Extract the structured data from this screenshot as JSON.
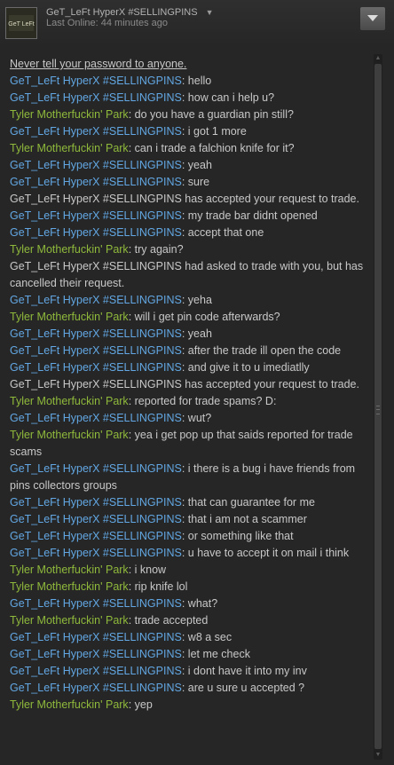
{
  "header": {
    "friend_name": "GeT_LeFt HyperX #SELLINGPINS",
    "last_online": "Last Online: 44 minutes ago",
    "menu_icon": "chevron-down-icon",
    "avatar_text": "GeT LeFt"
  },
  "chat": {
    "warning": "Never tell your password to anyone.",
    "messages": [
      {
        "type": "msg",
        "speaker": "get",
        "sender": "GeT_LeFt HyperX #SELLINGPINS",
        "text": ": hello"
      },
      {
        "type": "msg",
        "speaker": "get",
        "sender": "GeT_LeFt HyperX #SELLINGPINS",
        "text": ": how can i help u?"
      },
      {
        "type": "msg",
        "speaker": "tyler",
        "sender": "Tyler Motherfuckin' Park",
        "text": ": do you have a guardian pin still?"
      },
      {
        "type": "msg",
        "speaker": "get",
        "sender": "GeT_LeFt HyperX #SELLINGPINS",
        "text": ": i got 1 more"
      },
      {
        "type": "msg",
        "speaker": "tyler",
        "sender": "Tyler Motherfuckin' Park",
        "text": ": can i trade a falchion knife for it?"
      },
      {
        "type": "msg",
        "speaker": "get",
        "sender": "GeT_LeFt HyperX #SELLINGPINS",
        "text": ": yeah"
      },
      {
        "type": "msg",
        "speaker": "get",
        "sender": "GeT_LeFt HyperX #SELLINGPINS",
        "text": ": sure"
      },
      {
        "type": "sys",
        "text": "GeT_LeFt HyperX #SELLINGPINS has accepted your request to trade."
      },
      {
        "type": "msg",
        "speaker": "get",
        "sender": "GeT_LeFt HyperX #SELLINGPINS",
        "text": ": my trade bar didnt opened"
      },
      {
        "type": "msg",
        "speaker": "get",
        "sender": "GeT_LeFt HyperX #SELLINGPINS",
        "text": ": accept that one"
      },
      {
        "type": "msg",
        "speaker": "tyler",
        "sender": "Tyler Motherfuckin' Park",
        "text": ": try again?"
      },
      {
        "type": "sys",
        "text": "GeT_LeFt HyperX #SELLINGPINS had asked to trade with you, but has cancelled their request."
      },
      {
        "type": "msg",
        "speaker": "get",
        "sender": "GeT_LeFt HyperX #SELLINGPINS",
        "text": ": yeha"
      },
      {
        "type": "msg",
        "speaker": "tyler",
        "sender": "Tyler Motherfuckin' Park",
        "text": ": will i get pin code afterwards?"
      },
      {
        "type": "msg",
        "speaker": "get",
        "sender": "GeT_LeFt HyperX #SELLINGPINS",
        "text": ": yeah"
      },
      {
        "type": "msg",
        "speaker": "get",
        "sender": "GeT_LeFt HyperX #SELLINGPINS",
        "text": ": after the trade ill open the code"
      },
      {
        "type": "msg",
        "speaker": "get",
        "sender": "GeT_LeFt HyperX #SELLINGPINS",
        "text": ": and give it to u imediatlly"
      },
      {
        "type": "sys",
        "text": "GeT_LeFt HyperX #SELLINGPINS has accepted your request to trade."
      },
      {
        "type": "msg",
        "speaker": "tyler",
        "sender": "Tyler Motherfuckin' Park",
        "text": ": reported for trade spams? D:"
      },
      {
        "type": "msg",
        "speaker": "get",
        "sender": "GeT_LeFt HyperX #SELLINGPINS",
        "text": ": wut?"
      },
      {
        "type": "msg",
        "speaker": "tyler",
        "sender": "Tyler Motherfuckin' Park",
        "text": ": yea i get pop up that saids reported for trade scams"
      },
      {
        "type": "msg",
        "speaker": "get",
        "sender": "GeT_LeFt HyperX #SELLINGPINS",
        "text": ": i there is a bug i have friends from pins collectors groups"
      },
      {
        "type": "msg",
        "speaker": "get",
        "sender": "GeT_LeFt HyperX #SELLINGPINS",
        "text": ": that can guarantee for me"
      },
      {
        "type": "msg",
        "speaker": "get",
        "sender": "GeT_LeFt HyperX #SELLINGPINS",
        "text": ": that i am not a scammer"
      },
      {
        "type": "msg",
        "speaker": "get",
        "sender": "GeT_LeFt HyperX #SELLINGPINS",
        "text": ": or something like that"
      },
      {
        "type": "msg",
        "speaker": "get",
        "sender": "GeT_LeFt HyperX #SELLINGPINS",
        "text": ": u have to accept it on mail i think"
      },
      {
        "type": "msg",
        "speaker": "tyler",
        "sender": "Tyler Motherfuckin' Park",
        "text": ": i know"
      },
      {
        "type": "msg",
        "speaker": "tyler",
        "sender": "Tyler Motherfuckin' Park",
        "text": ": rip knife lol"
      },
      {
        "type": "msg",
        "speaker": "get",
        "sender": "GeT_LeFt HyperX #SELLINGPINS",
        "text": ": what?"
      },
      {
        "type": "msg",
        "speaker": "tyler",
        "sender": "Tyler Motherfuckin' Park",
        "text": ": trade accepted"
      },
      {
        "type": "msg",
        "speaker": "get",
        "sender": "GeT_LeFt HyperX #SELLINGPINS",
        "text": ": w8 a sec"
      },
      {
        "type": "msg",
        "speaker": "get",
        "sender": "GeT_LeFt HyperX #SELLINGPINS",
        "text": ": let me check"
      },
      {
        "type": "msg",
        "speaker": "get",
        "sender": "GeT_LeFt HyperX #SELLINGPINS",
        "text": ": i dont have it into my inv"
      },
      {
        "type": "msg",
        "speaker": "get",
        "sender": "GeT_LeFt HyperX #SELLINGPINS",
        "text": ": are u sure u accepted ?"
      },
      {
        "type": "msg",
        "speaker": "tyler",
        "sender": "Tyler Motherfuckin' Park",
        "text": ": yep"
      }
    ]
  },
  "colors": {
    "friend": "#62a7e3",
    "self": "#8fb93b",
    "text": "#c8c8c8",
    "background": "#262626"
  }
}
